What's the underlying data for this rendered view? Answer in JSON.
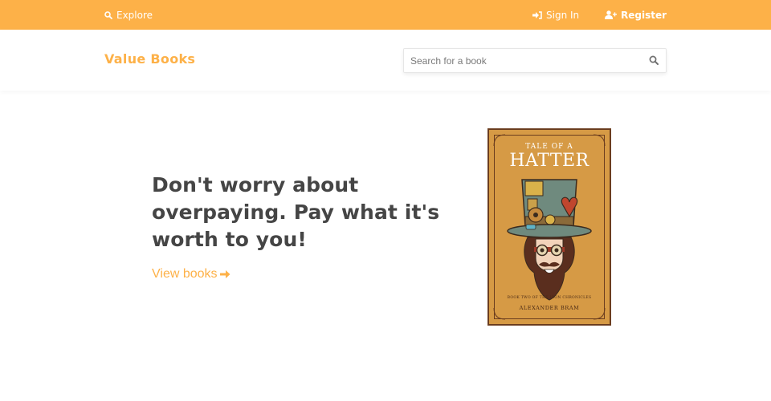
{
  "topbar": {
    "explore_label": "Explore",
    "signin_label": "Sign In",
    "register_label": "Register"
  },
  "header": {
    "brand": "Value Books",
    "search_placeholder": "Search for a book"
  },
  "hero": {
    "headline_line1": "Don't worry about",
    "headline_line2": "overpaying. Pay what it's",
    "headline_line3": "worth to you!",
    "cta_label": "View books"
  },
  "book": {
    "title_small": "TALE OF A",
    "title_large": "HATTER",
    "series": "BOOK TWO OF THE IRON CHRONICLES",
    "author": "ALEXANDER BRAM"
  },
  "colors": {
    "accent": "#fdb148",
    "heading": "#454545",
    "cover_bg": "#d69a45",
    "cover_border": "#6b3d1f"
  },
  "icons": {
    "explore": "search-icon",
    "signin": "sign-in-icon",
    "register": "user-plus-icon",
    "search": "search-icon",
    "cta": "arrow-right-icon"
  }
}
